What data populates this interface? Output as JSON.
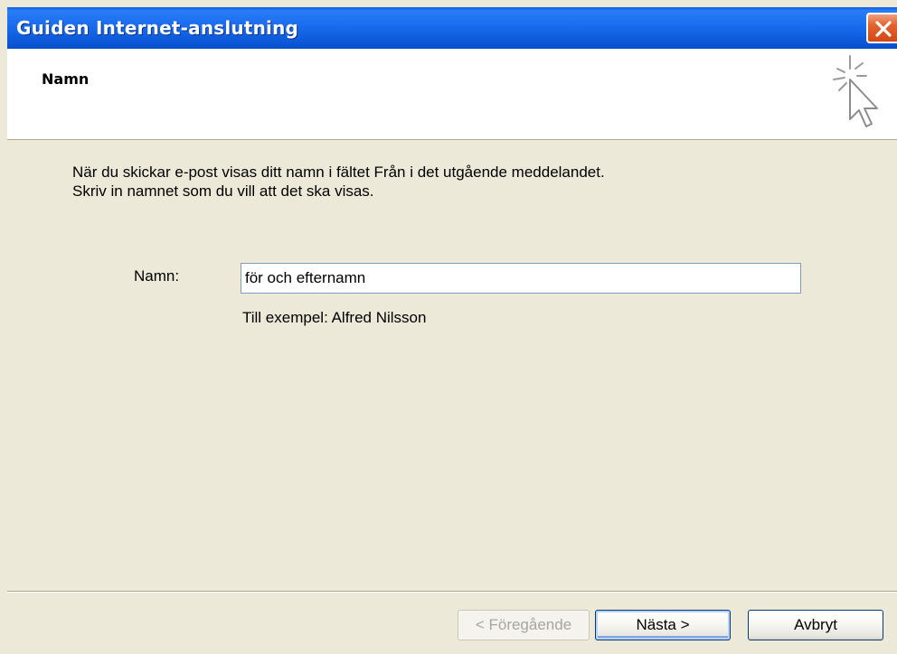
{
  "window": {
    "title": "Guiden Internet-anslutning"
  },
  "header": {
    "title": "Namn"
  },
  "body": {
    "line1": "När du skickar e-post visas ditt namn i fältet Från i det utgående meddelandet.",
    "line2": "Skriv in namnet som du vill att det ska visas."
  },
  "form": {
    "name_label": "Namn:",
    "name_value": "för och efternamn",
    "example": "Till exempel: Alfred Nilsson"
  },
  "buttons": {
    "back": "< Föregående",
    "next": "Nästa >",
    "cancel": "Avbryt"
  },
  "icons": {
    "close": "close-icon",
    "wizard": "cursor-sparkle-icon"
  },
  "colors": {
    "titlebar": "#0b58d8",
    "close_button": "#d24817",
    "dialog_bg": "#ece9d8"
  }
}
